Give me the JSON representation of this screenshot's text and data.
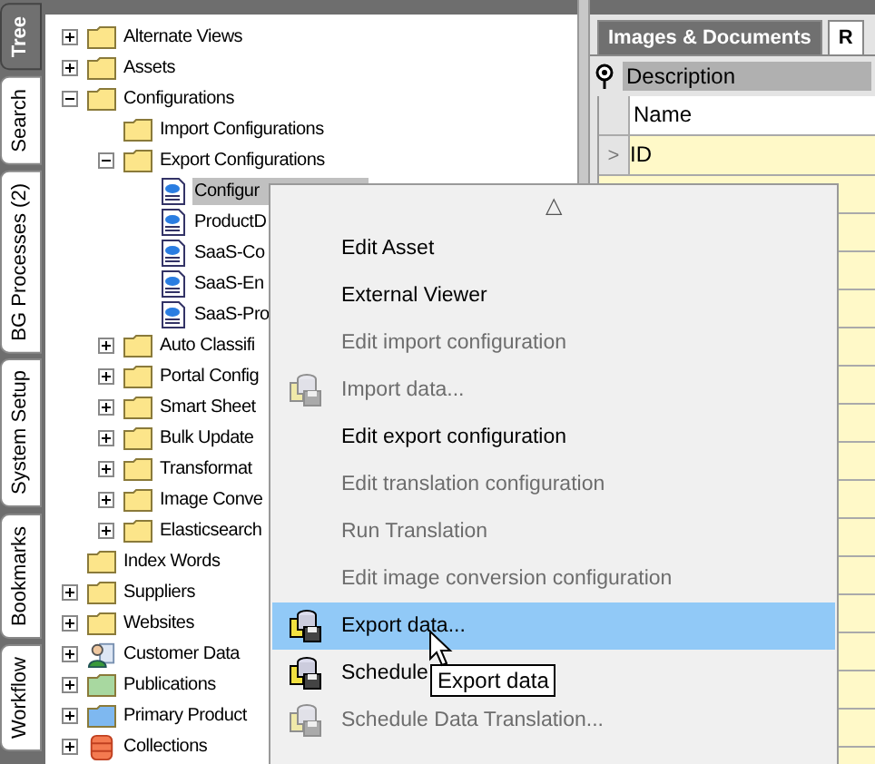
{
  "side_tabs": [
    {
      "label": "Tree",
      "selected": true
    },
    {
      "label": "Search",
      "selected": false
    },
    {
      "label": "BG Processes (2)",
      "selected": false
    },
    {
      "label": "System Setup",
      "selected": false
    },
    {
      "label": "Bookmarks",
      "selected": false
    },
    {
      "label": "Workflow",
      "selected": false
    }
  ],
  "tree": [
    {
      "label": "Alternate Views",
      "kind": "folder",
      "color": "#fce58a",
      "expanded": false,
      "selected": false
    },
    {
      "label": "Assets",
      "kind": "folder",
      "color": "#fce58a",
      "expanded": false,
      "selected": false
    },
    {
      "label": "Configurations",
      "kind": "folder",
      "color": "#fce58a",
      "expanded": true,
      "selected": false,
      "children": [
        {
          "label": "Import Configurations",
          "kind": "folder",
          "color": "#fce58a",
          "leaf": true,
          "selected": false
        },
        {
          "label": "Export Configurations",
          "kind": "folder",
          "color": "#fce58a",
          "expanded": true,
          "selected": false,
          "children": [
            {
              "label": "Configur",
              "kind": "document",
              "leaf": true,
              "selected": true
            },
            {
              "label": "ProductD",
              "kind": "document",
              "leaf": true,
              "selected": false
            },
            {
              "label": "SaaS-Co",
              "kind": "document",
              "leaf": true,
              "selected": false
            },
            {
              "label": "SaaS-En",
              "kind": "document",
              "leaf": true,
              "selected": false
            },
            {
              "label": "SaaS-Pro",
              "kind": "document",
              "leaf": true,
              "selected": false
            }
          ]
        },
        {
          "label": "Auto Classifi",
          "kind": "folder",
          "color": "#fce58a",
          "expanded": false,
          "selected": false
        },
        {
          "label": "Portal Config",
          "kind": "folder",
          "color": "#fce58a",
          "expanded": false,
          "selected": false
        },
        {
          "label": "Smart Sheet",
          "kind": "folder",
          "color": "#fce58a",
          "expanded": false,
          "selected": false
        },
        {
          "label": "Bulk Update",
          "kind": "folder",
          "color": "#fce58a",
          "expanded": false,
          "selected": false
        },
        {
          "label": "Transformat",
          "kind": "folder",
          "color": "#fce58a",
          "expanded": false,
          "selected": false
        },
        {
          "label": "Image Conve",
          "kind": "folder",
          "color": "#fce58a",
          "expanded": false,
          "selected": false
        },
        {
          "label": "Elasticsearch",
          "kind": "folder",
          "color": "#fce58a",
          "expanded": false,
          "selected": false
        }
      ]
    },
    {
      "label": "Index Words",
      "kind": "folder",
      "color": "#fce58a",
      "leaf": true,
      "selected": false
    },
    {
      "label": "Suppliers",
      "kind": "folder",
      "color": "#fce58a",
      "expanded": false,
      "selected": false
    },
    {
      "label": "Websites",
      "kind": "folder",
      "color": "#fce58a",
      "expanded": false,
      "selected": false
    },
    {
      "label": "Customer Data",
      "kind": "person",
      "expanded": false,
      "selected": false
    },
    {
      "label": "Publications",
      "kind": "folder",
      "color": "#a8d8a0",
      "expanded": false,
      "selected": false
    },
    {
      "label": "Primary Product",
      "kind": "folder",
      "color": "#7eb8f0",
      "expanded": false,
      "selected": false
    },
    {
      "label": "Collections",
      "kind": "stack",
      "expanded": false,
      "selected": false
    }
  ],
  "right_panel": {
    "tabs": [
      {
        "label": "Images & Documents",
        "selected": true
      },
      {
        "label": "R",
        "selected": false
      }
    ],
    "filter_label": "Description",
    "columns": [
      "Name"
    ],
    "rows": [
      {
        "indicator": ">",
        "name": "ID"
      }
    ]
  },
  "context_menu": {
    "scroll_up": "△",
    "items": [
      {
        "label": "Edit Asset",
        "disabled": false,
        "kind": "plain",
        "selected": false
      },
      {
        "label": "External Viewer",
        "disabled": false,
        "kind": "plain",
        "selected": false
      },
      {
        "label": "Edit import configuration",
        "disabled": true,
        "kind": "plain",
        "selected": false
      },
      {
        "label": "Import data...",
        "disabled": true,
        "kind": "database",
        "selected": false
      },
      {
        "label": "Edit export configuration",
        "disabled": false,
        "kind": "plain",
        "selected": false
      },
      {
        "label": "Edit translation configuration",
        "disabled": true,
        "kind": "plain",
        "selected": false
      },
      {
        "label": "Run Translation",
        "disabled": true,
        "kind": "plain",
        "selected": false
      },
      {
        "label": "Edit image conversion configuration",
        "disabled": true,
        "kind": "plain",
        "selected": false
      },
      {
        "label": "Export data...",
        "disabled": false,
        "kind": "database",
        "selected": true
      },
      {
        "label": "Schedule",
        "disabled": false,
        "kind": "database",
        "selected": false
      },
      {
        "label": "Schedule Data Translation...",
        "disabled": true,
        "kind": "database",
        "selected": false
      }
    ]
  },
  "tooltip": "Export data"
}
